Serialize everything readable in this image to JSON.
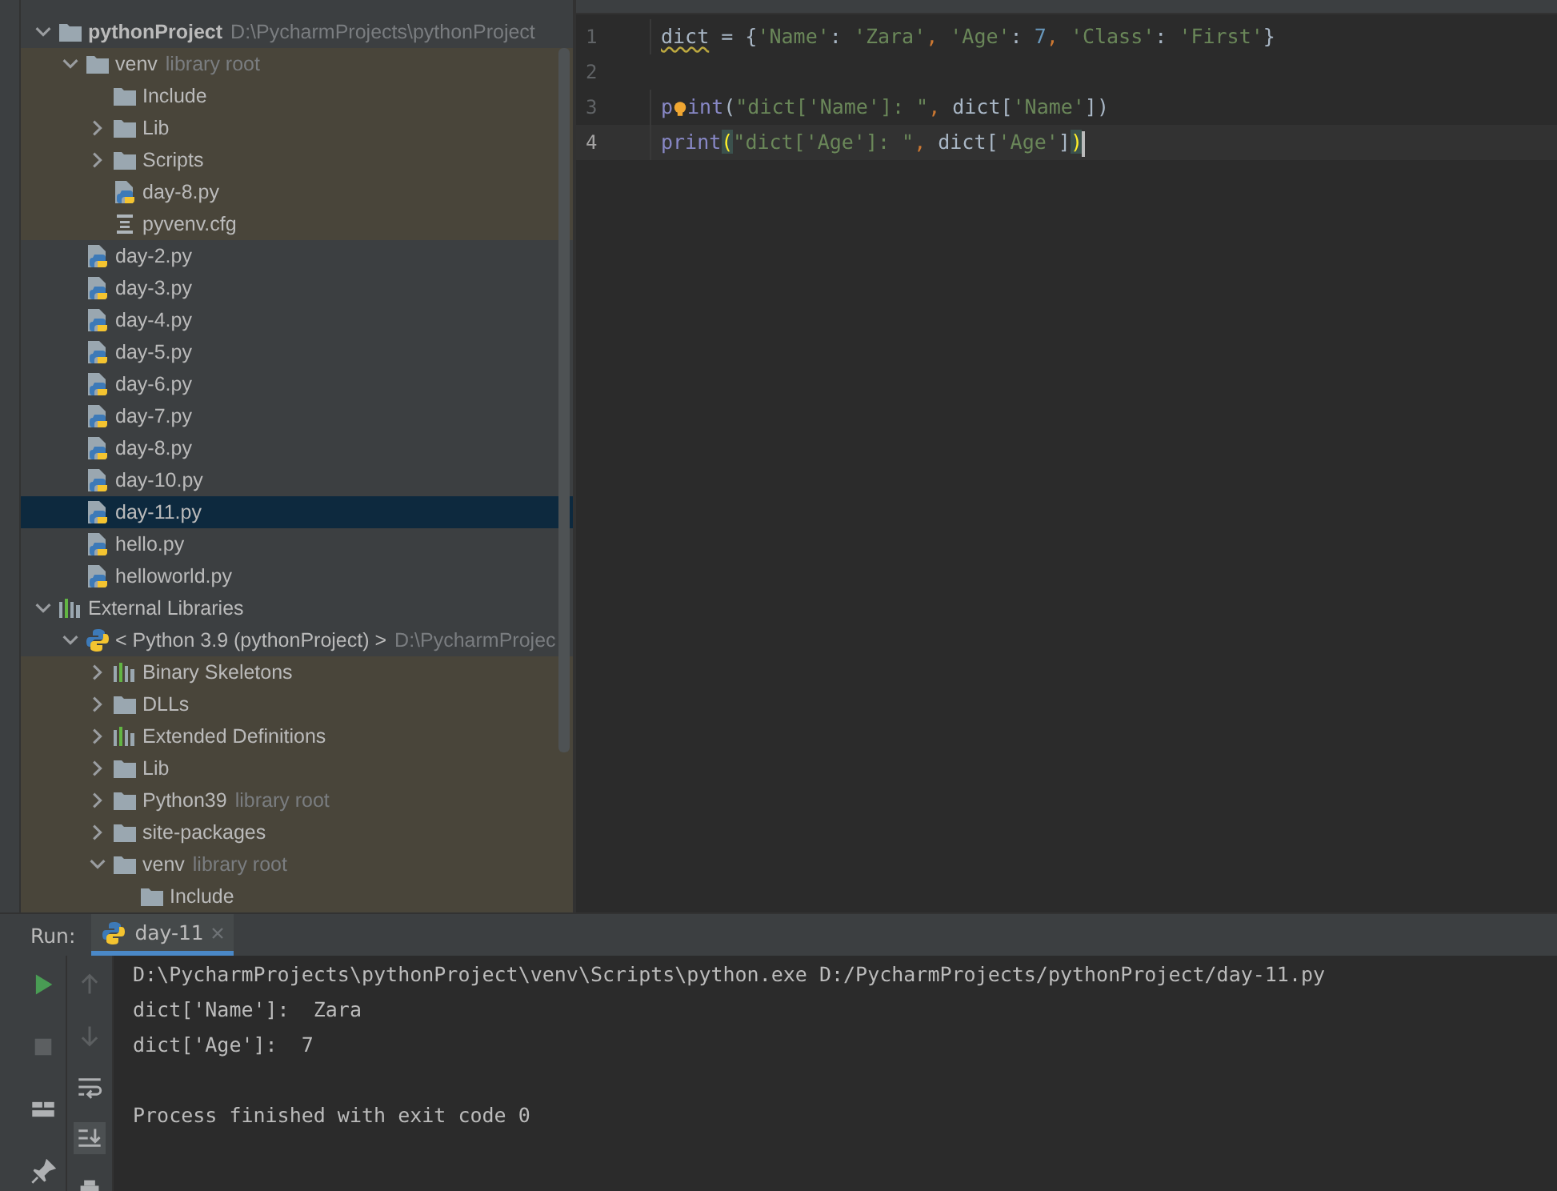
{
  "project_tree": [
    {
      "name": "pythonProject",
      "hint": "D:\\PycharmProjects\\pythonProject",
      "kind": "folder",
      "bold": true,
      "expanded": true,
      "selected": false,
      "shaded": false,
      "children": [
        {
          "name": "venv",
          "hint": "library root",
          "kind": "folder",
          "expanded": true,
          "selected": false,
          "shaded": true,
          "children": [
            {
              "name": "Include",
              "kind": "folder",
              "selected": false,
              "shaded": true
            },
            {
              "name": "Lib",
              "kind": "folder",
              "expanded": false,
              "selected": false,
              "shaded": true
            },
            {
              "name": "Scripts",
              "kind": "folder",
              "expanded": false,
              "selected": false,
              "shaded": true
            },
            {
              "name": "day-8.py",
              "kind": "python",
              "selected": false,
              "shaded": true
            },
            {
              "name": "pyvenv.cfg",
              "kind": "config",
              "selected": false,
              "shaded": true
            }
          ]
        },
        {
          "name": "day-2.py",
          "kind": "python",
          "selected": false,
          "shaded": false
        },
        {
          "name": "day-3.py",
          "kind": "python",
          "selected": false,
          "shaded": false
        },
        {
          "name": "day-4.py",
          "kind": "python",
          "selected": false,
          "shaded": false
        },
        {
          "name": "day-5.py",
          "kind": "python",
          "selected": false,
          "shaded": false
        },
        {
          "name": "day-6.py",
          "kind": "python",
          "selected": false,
          "shaded": false
        },
        {
          "name": "day-7.py",
          "kind": "python",
          "selected": false,
          "shaded": false
        },
        {
          "name": "day-8.py",
          "kind": "python",
          "selected": false,
          "shaded": false
        },
        {
          "name": "day-10.py",
          "kind": "python",
          "selected": false,
          "shaded": false
        },
        {
          "name": "day-11.py",
          "kind": "python",
          "selected": true,
          "shaded": false
        },
        {
          "name": "hello.py",
          "kind": "python",
          "selected": false,
          "shaded": false
        },
        {
          "name": "helloworld.py",
          "kind": "python",
          "selected": false,
          "shaded": false
        }
      ]
    },
    {
      "name": "External Libraries",
      "kind": "library",
      "expanded": true,
      "selected": false,
      "shaded": false,
      "children": [
        {
          "name": "< Python 3.9 (pythonProject) >",
          "hint": "D:\\PycharmProjec",
          "kind": "sdk",
          "expanded": true,
          "selected": false,
          "shaded": false,
          "children": [
            {
              "name": "Binary Skeletons",
              "kind": "library",
              "expanded": false,
              "selected": false,
              "shaded": true
            },
            {
              "name": "DLLs",
              "kind": "folder",
              "expanded": false,
              "selected": false,
              "shaded": true
            },
            {
              "name": "Extended Definitions",
              "kind": "library",
              "expanded": false,
              "selected": false,
              "shaded": true
            },
            {
              "name": "Lib",
              "kind": "folder",
              "expanded": false,
              "selected": false,
              "shaded": true
            },
            {
              "name": "Python39",
              "hint": "library root",
              "kind": "folder",
              "expanded": false,
              "selected": false,
              "shaded": true
            },
            {
              "name": "site-packages",
              "kind": "folder",
              "expanded": false,
              "selected": false,
              "shaded": true
            },
            {
              "name": "venv",
              "hint": "library root",
              "kind": "folder",
              "expanded": true,
              "selected": false,
              "shaded": true,
              "children": [
                {
                  "name": "Include",
                  "kind": "folder",
                  "selected": false,
                  "shaded": true
                }
              ]
            }
          ]
        }
      ]
    }
  ],
  "editor": {
    "lines": [
      {
        "number": "1",
        "current": false,
        "tokens": [
          {
            "text": "dict",
            "kind": "warning"
          },
          {
            "text": " = {",
            "kind": "plain"
          },
          {
            "text": "'Name'",
            "kind": "string"
          },
          {
            "text": ": ",
            "kind": "plain"
          },
          {
            "text": "'Zara'",
            "kind": "string"
          },
          {
            "text": ", ",
            "kind": "comma"
          },
          {
            "text": "'Age'",
            "kind": "string"
          },
          {
            "text": ": ",
            "kind": "plain"
          },
          {
            "text": "7",
            "kind": "number"
          },
          {
            "text": ", ",
            "kind": "comma"
          },
          {
            "text": "'Class'",
            "kind": "string"
          },
          {
            "text": ": ",
            "kind": "plain"
          },
          {
            "text": "'First'",
            "kind": "string"
          },
          {
            "text": "}",
            "kind": "plain"
          }
        ]
      },
      {
        "number": "2",
        "current": false
      },
      {
        "number": "3",
        "current": false,
        "bulb": true,
        "tokens": [
          {
            "text": "p",
            "kind": "builtin"
          },
          {
            "text": "int",
            "kind": "builtin"
          },
          {
            "text": "(",
            "kind": "plain"
          },
          {
            "text": "\"dict['Name']: \"",
            "kind": "string"
          },
          {
            "text": ", ",
            "kind": "comma"
          },
          {
            "text": "dict[",
            "kind": "plain"
          },
          {
            "text": "'Name'",
            "kind": "string"
          },
          {
            "text": "])",
            "kind": "plain"
          }
        ]
      },
      {
        "number": "4",
        "current": true,
        "tokens": [
          {
            "text": "print",
            "kind": "builtin"
          },
          {
            "text": "(",
            "kind": "match"
          },
          {
            "text": "\"dict['Age']: \"",
            "kind": "string"
          },
          {
            "text": ", ",
            "kind": "comma"
          },
          {
            "text": "dict[",
            "kind": "plain"
          },
          {
            "text": "'Age'",
            "kind": "string"
          },
          {
            "text": "]",
            "kind": "plain"
          },
          {
            "text": ")",
            "kind": "match"
          }
        ]
      }
    ]
  },
  "run_panel": {
    "label": "Run:",
    "tabs": [
      {
        "label": "day-11",
        "selected": true
      }
    ],
    "output": [
      "D:\\PycharmProjects\\pythonProject\\venv\\Scripts\\python.exe D:/PycharmProjects/pythonProject/day-11.py",
      "dict['Name']:  Zara",
      "dict['Age']:  7"
    ],
    "exit_message": "Process finished with exit code 0"
  }
}
